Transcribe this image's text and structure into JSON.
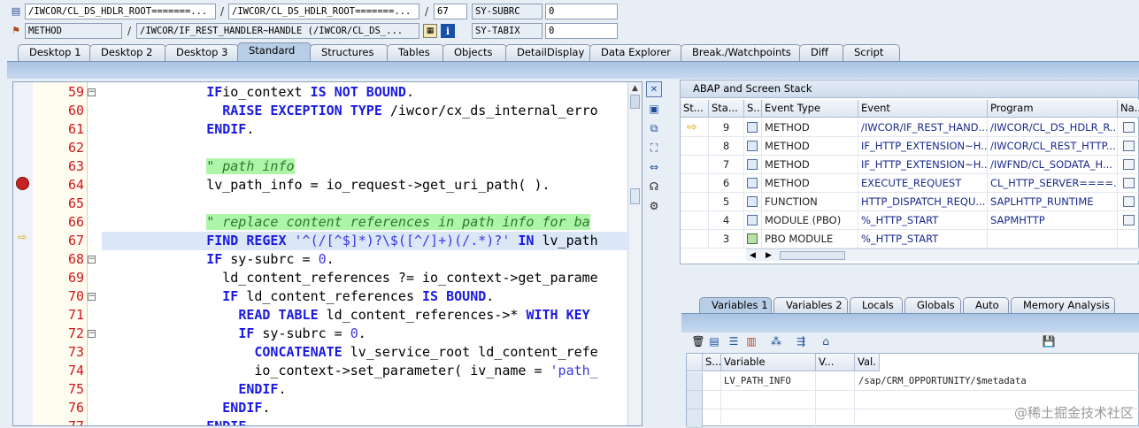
{
  "top_fields": {
    "row1": {
      "field1": "/IWCOR/CL_DS_HDLR_ROOT=======...",
      "sep1": "/",
      "field2": "/IWCOR/CL_DS_HDLR_ROOT=======...",
      "sep2": "/",
      "line": "67",
      "sysvar_name": "SY-SUBRC",
      "sysvar_value": "0"
    },
    "row2": {
      "kind": "METHOD",
      "sep": "/",
      "method": "/IWCOR/IF_REST_HANDLER~HANDLE (/IWCOR/CL_DS_...",
      "sysvar_name": "SY-TABIX",
      "sysvar_value": "0"
    }
  },
  "desktop_tabs": [
    "Desktop 1",
    "Desktop 2",
    "Desktop 3",
    "Standard",
    "Structures",
    "Tables",
    "Objects",
    "DetailDisplay",
    "Data Explorer",
    "Break./Watchpoints",
    "Diff",
    "Script"
  ],
  "active_desktop_tab": "Standard",
  "code_lines": [
    {
      "no": "59",
      "indent": "      ",
      "parts": [
        [
          "kw",
          "IF"
        ],
        [
          "",
          "io_context "
        ],
        [
          "kw",
          "IS NOT BOUND"
        ],
        [
          "",
          "."
        ]
      ]
    },
    {
      "no": "60",
      "indent": "        ",
      "parts": [
        [
          "kw",
          "RAISE EXCEPTION TYPE"
        ],
        [
          "",
          " /iwcor/cx_ds_internal_erro"
        ]
      ]
    },
    {
      "no": "61",
      "indent": "      ",
      "parts": [
        [
          "kw",
          "ENDIF"
        ],
        [
          "",
          "."
        ]
      ]
    },
    {
      "no": "62",
      "indent": "",
      "parts": []
    },
    {
      "no": "63",
      "indent": "      ",
      "parts": [
        [
          "cm",
          "\" path info"
        ]
      ]
    },
    {
      "no": "64",
      "indent": "      ",
      "parts": [
        [
          "",
          "lv_path_info = io_request->get_uri_path( )."
        ]
      ]
    },
    {
      "no": "65",
      "indent": "",
      "parts": []
    },
    {
      "no": "66",
      "indent": "      ",
      "parts": [
        [
          "cm",
          "\" replace content references in path info for ba"
        ]
      ]
    },
    {
      "no": "67",
      "indent": "      ",
      "parts": [
        [
          "kw",
          "FIND REGEX"
        ],
        [
          "",
          " "
        ],
        [
          "str",
          "'^(/[^$]*)?\\$([^/]+)(/.*)?'"
        ],
        [
          "",
          " "
        ],
        [
          "kw",
          "IN"
        ],
        [
          "",
          " lv_path"
        ]
      ]
    },
    {
      "no": "68",
      "indent": "      ",
      "parts": [
        [
          "kw",
          "IF"
        ],
        [
          "",
          " sy-subrc = "
        ],
        [
          "str",
          "0"
        ],
        [
          "",
          "."
        ]
      ]
    },
    {
      "no": "69",
      "indent": "        ",
      "parts": [
        [
          "",
          "ld_content_references ?= io_context->get_parame"
        ]
      ]
    },
    {
      "no": "70",
      "indent": "        ",
      "parts": [
        [
          "kw",
          "IF"
        ],
        [
          "",
          " ld_content_references "
        ],
        [
          "kw",
          "IS BOUND"
        ],
        [
          "",
          "."
        ]
      ]
    },
    {
      "no": "71",
      "indent": "          ",
      "parts": [
        [
          "kw",
          "READ TABLE"
        ],
        [
          "",
          " ld_content_references->* "
        ],
        [
          "kw",
          "WITH KEY"
        ]
      ]
    },
    {
      "no": "72",
      "indent": "          ",
      "parts": [
        [
          "kw",
          "IF"
        ],
        [
          "",
          " sy-subrc = "
        ],
        [
          "str",
          "0"
        ],
        [
          "",
          "."
        ]
      ]
    },
    {
      "no": "73",
      "indent": "            ",
      "parts": [
        [
          "kw",
          "CONCATENATE"
        ],
        [
          "",
          " lv_service_root ld_content_refe"
        ]
      ]
    },
    {
      "no": "74",
      "indent": "            ",
      "parts": [
        [
          "",
          "io_context->set_parameter( iv_name = "
        ],
        [
          "str",
          "'path_"
        ]
      ]
    },
    {
      "no": "75",
      "indent": "          ",
      "parts": [
        [
          "kw",
          "ENDIF"
        ],
        [
          "",
          "."
        ]
      ]
    },
    {
      "no": "76",
      "indent": "        ",
      "parts": [
        [
          "kw",
          "ENDIF"
        ],
        [
          "",
          "."
        ]
      ]
    },
    {
      "no": "77",
      "indent": "      ",
      "parts": [
        [
          "kw",
          "ENDIF"
        ],
        [
          "",
          "."
        ]
      ]
    }
  ],
  "stack": {
    "title": "ABAP and Screen Stack",
    "columns": [
      "St...",
      "Sta...",
      "S...",
      "Event Type",
      "Event",
      "Program",
      "Na..."
    ],
    "rows": [
      {
        "level": "9",
        "event_type": "METHOD",
        "event": "/IWCOR/IF_REST_HAND...",
        "program": "/IWCOR/CL_DS_HDLR_R...",
        "current": true
      },
      {
        "level": "8",
        "event_type": "METHOD",
        "event": "IF_HTTP_EXTENSION~H...",
        "program": "/IWCOR/CL_REST_HTTP...",
        "current": false
      },
      {
        "level": "7",
        "event_type": "METHOD",
        "event": "IF_HTTP_EXTENSION~H...",
        "program": "/IWFND/CL_SODATA_H...",
        "current": false
      },
      {
        "level": "6",
        "event_type": "METHOD",
        "event": "EXECUTE_REQUEST",
        "program": "CL_HTTP_SERVER====...",
        "current": false
      },
      {
        "level": "5",
        "event_type": "FUNCTION",
        "event": "HTTP_DISPATCH_REQU...",
        "program": "SAPLHTTP_RUNTIME",
        "current": false
      },
      {
        "level": "4",
        "event_type": "MODULE (PBO)",
        "event": "%_HTTP_START",
        "program": "SAPMHTTP",
        "current": false
      },
      {
        "level": "3",
        "event_type": "PBO MODULE",
        "event": "%_HTTP_START",
        "program": "",
        "current": false
      }
    ]
  },
  "var_tabs": [
    "Variables 1",
    "Variables 2",
    "Locals",
    "Globals",
    "Auto",
    "Memory Analysis"
  ],
  "active_var_tab": "Variables 1",
  "variables": {
    "columns": [
      "S...",
      "Variable",
      "V...",
      "Val."
    ],
    "rows": [
      {
        "name": "LV_PATH_INFO",
        "value": "/sap/CRM_OPPORTUNITY/$metadata"
      }
    ]
  },
  "watermark": "@稀土掘金技术社区",
  "colors": {
    "accent": "#b8cde6",
    "line_number": "#d4141a",
    "keyword": "#1a1ae0",
    "comment_bg": "#aef5a8"
  }
}
